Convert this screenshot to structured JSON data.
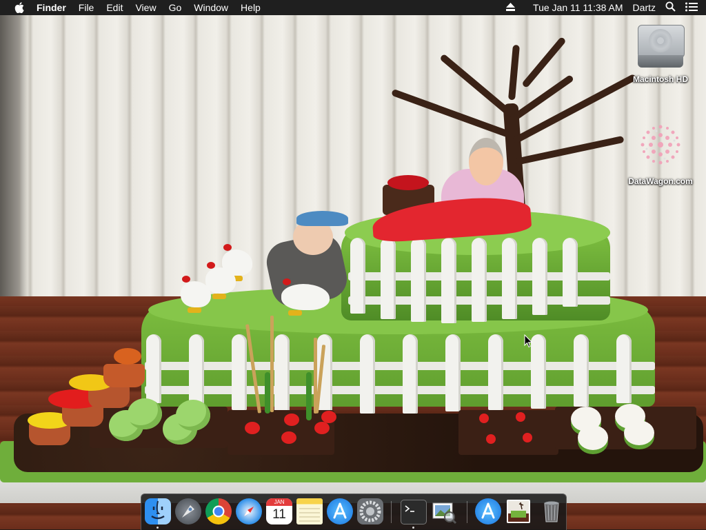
{
  "menubar": {
    "apple_icon": "apple-logo-icon",
    "app_name": "Finder",
    "menus": [
      "File",
      "Edit",
      "View",
      "Go",
      "Window",
      "Help"
    ],
    "status": {
      "eject_icon": "eject-icon",
      "clock": "Tue Jan 11  11:38 AM",
      "user": "Dartz",
      "search_icon": "spotlight-search-icon",
      "list_icon": "notification-center-icon"
    }
  },
  "desktop": {
    "wallpaper": "garden cake with elderly couple, fence, chickens, vegetables",
    "icons": [
      {
        "label": "Macintosh HD",
        "icon": "hard-drive-icon"
      },
      {
        "label": "DataWagon.com",
        "icon": "datawagon-logo-icon"
      }
    ]
  },
  "dock": {
    "apps": [
      {
        "name": "Finder",
        "icon": "finder-icon",
        "running": true
      },
      {
        "name": "Launchpad",
        "icon": "launchpad-icon",
        "running": false
      },
      {
        "name": "Google Chrome",
        "icon": "chrome-icon",
        "running": false
      },
      {
        "name": "Safari",
        "icon": "safari-icon",
        "running": false
      },
      {
        "name": "Calendar",
        "icon": "calendar-icon",
        "running": false,
        "month": "JAN",
        "day": "11"
      },
      {
        "name": "Notes",
        "icon": "notes-icon",
        "running": false
      },
      {
        "name": "App Store",
        "icon": "app-store-icon",
        "running": false
      },
      {
        "name": "System Preferences",
        "icon": "system-preferences-icon",
        "running": false
      },
      {
        "name": "Terminal",
        "icon": "terminal-icon",
        "running": true
      },
      {
        "name": "Preview",
        "icon": "preview-icon",
        "running": false
      },
      {
        "name": "App Store (download)",
        "icon": "app-store-download-icon",
        "running": false
      },
      {
        "name": "Wallpaper image",
        "icon": "image-thumbnail-icon",
        "running": false
      },
      {
        "name": "Trash",
        "icon": "trash-icon",
        "running": false
      }
    ]
  },
  "colors": {
    "menubar_bg": "#1f1f1f",
    "grass": "#6fae3b",
    "fence": "#f2f2ee"
  }
}
